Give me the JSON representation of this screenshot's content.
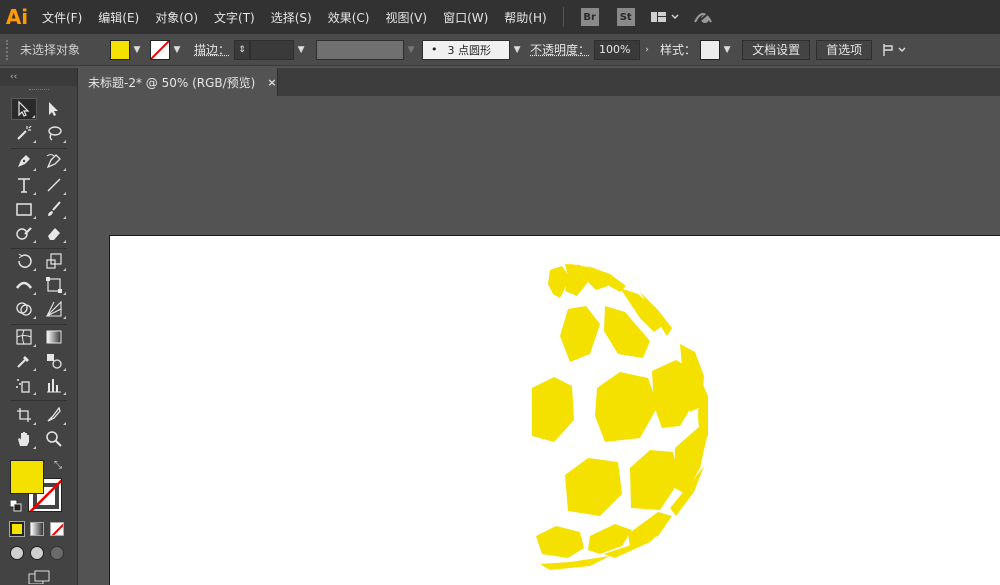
{
  "app": {
    "logo": "Ai"
  },
  "menu": {
    "items": [
      "文件(F)",
      "编辑(E)",
      "对象(O)",
      "文字(T)",
      "选择(S)",
      "效果(C)",
      "视图(V)",
      "窗口(W)",
      "帮助(H)"
    ],
    "bridge": "Br",
    "stock": "St"
  },
  "control": {
    "selection_status": "未选择对象",
    "fill_color": "#f5e100",
    "stroke_label": "描边：",
    "stroke_value": "",
    "brush_value": "3 点圆形",
    "brush_dot": "•",
    "opacity_label": "不透明度：",
    "opacity_value": "100%",
    "style_label": "样式：",
    "doc_settings_button": "文档设置",
    "preferences_button": "首选项"
  },
  "toolbar": {
    "collapse_glyph": "‹‹",
    "fill_color": "#f5e100",
    "stroke_color": "#ffffff"
  },
  "document": {
    "tab_title": "未标题-2* @ 50% (RGB/预览)",
    "close_glyph": "×"
  },
  "artwork": {
    "shape_color": "#f5e100",
    "description_icon": "hexagon-sphere-artwork"
  }
}
